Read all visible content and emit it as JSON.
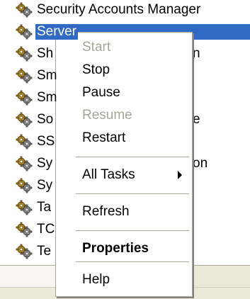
{
  "services": [
    {
      "name": "Security Accounts Manager",
      "selected": false,
      "tail": ""
    },
    {
      "name": "Server",
      "selected": true,
      "tail": ""
    },
    {
      "name": "Sh",
      "selected": false,
      "tail": "n"
    },
    {
      "name": "Sm",
      "selected": false,
      "tail": ""
    },
    {
      "name": "Sm",
      "selected": false,
      "tail": ""
    },
    {
      "name": "So",
      "selected": false,
      "tail": "e"
    },
    {
      "name": "SS",
      "selected": false,
      "tail": ""
    },
    {
      "name": "Sy",
      "selected": false,
      "tail": "on"
    },
    {
      "name": "Sy",
      "selected": false,
      "tail": ""
    },
    {
      "name": "Ta",
      "selected": false,
      "tail": ""
    },
    {
      "name": "TC",
      "selected": false,
      "tail": ""
    },
    {
      "name": "Te",
      "selected": false,
      "tail": ""
    }
  ],
  "service_icon": "gear-pair-icon",
  "context_menu": {
    "items": [
      {
        "label": "Start",
        "disabled": true,
        "bold": false,
        "submenu": false
      },
      {
        "label": "Stop",
        "disabled": false,
        "bold": false,
        "submenu": false
      },
      {
        "label": "Pause",
        "disabled": false,
        "bold": false,
        "submenu": false
      },
      {
        "label": "Resume",
        "disabled": true,
        "bold": false,
        "submenu": false
      },
      {
        "label": "Restart",
        "disabled": false,
        "bold": false,
        "submenu": false
      },
      {
        "label": "All Tasks",
        "disabled": false,
        "bold": false,
        "submenu": true
      },
      {
        "label": "Refresh",
        "disabled": false,
        "bold": false,
        "submenu": false
      },
      {
        "label": "Properties",
        "disabled": false,
        "bold": true,
        "submenu": false
      },
      {
        "label": "Help",
        "disabled": false,
        "bold": false,
        "submenu": false
      }
    ]
  },
  "colors": {
    "selection": "#316ac5",
    "disabled_text": "#a7a59b",
    "menu_border": "#aca899",
    "status_bar": "#ece9d8"
  }
}
